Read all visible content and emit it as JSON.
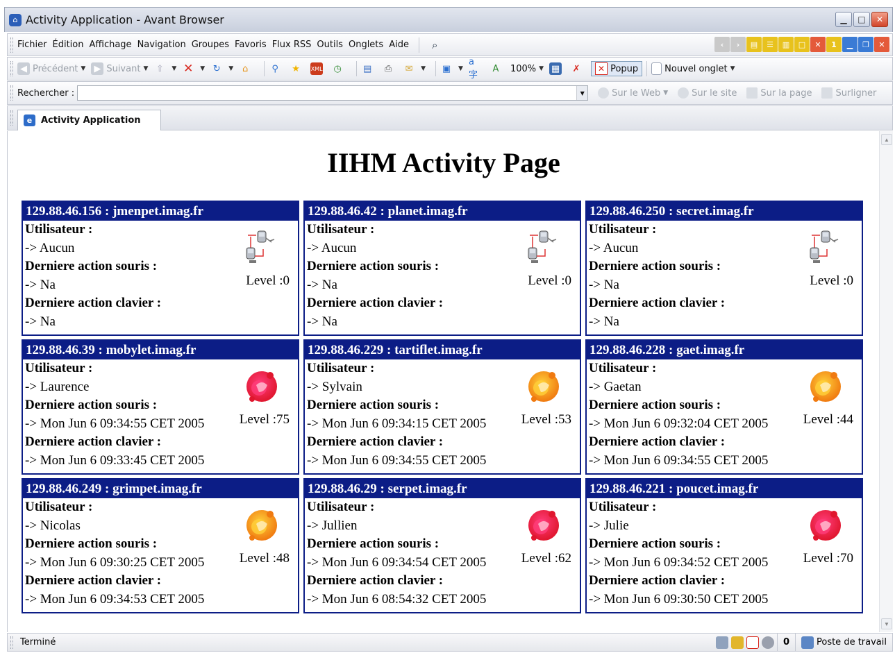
{
  "window": {
    "title": "Activity Application - Avant Browser"
  },
  "menu": [
    "Fichier",
    "Édition",
    "Affichage",
    "Navigation",
    "Groupes",
    "Favoris",
    "Flux RSS",
    "Outils",
    "Onglets",
    "Aide"
  ],
  "toolbar": {
    "back": "Précédent",
    "forward": "Suivant",
    "zoom": "100%",
    "popup": "Popup",
    "new_tab": "Nouvel onglet"
  },
  "search": {
    "label": "Rechercher :",
    "value": "",
    "web": "Sur le Web",
    "site": "Sur le site",
    "page": "Sur la page",
    "highlight": "Surligner"
  },
  "tab": {
    "label": "Activity Application"
  },
  "page": {
    "title": "IIHM Activity Page",
    "labels": {
      "user": "Utilisateur :",
      "mouse": "Derniere action souris :",
      "keyboard": "Derniere action clavier :"
    }
  },
  "machines": [
    {
      "header": "129.88.46.156 : jmenpet.imag.fr",
      "user": "-> Aucun",
      "mouse": "-> Na",
      "keyboard": "-> Na",
      "level": "Level :0",
      "level_value": 0,
      "state": "idle"
    },
    {
      "header": "129.88.46.42 : planet.imag.fr",
      "user": "-> Aucun",
      "mouse": "-> Na",
      "keyboard": "-> Na",
      "level": "Level :0",
      "level_value": 0,
      "state": "idle"
    },
    {
      "header": "129.88.46.250 : secret.imag.fr",
      "user": "-> Aucun",
      "mouse": "-> Na",
      "keyboard": "-> Na",
      "level": "Level :0",
      "level_value": 0,
      "state": "idle"
    },
    {
      "header": "129.88.46.39 : mobylet.imag.fr",
      "user": "-> Laurence",
      "mouse": "-> Mon Jun 6 09:34:55 CET 2005",
      "keyboard": "-> Mon Jun 6 09:33:45 CET 2005",
      "level": "Level :75",
      "level_value": 75,
      "state": "active"
    },
    {
      "header": "129.88.46.229 : tartiflet.imag.fr",
      "user": "-> Sylvain",
      "mouse": "-> Mon Jun 6 09:34:15 CET 2005",
      "keyboard": "-> Mon Jun 6 09:34:55 CET 2005",
      "level": "Level :53",
      "level_value": 53,
      "state": "active"
    },
    {
      "header": "129.88.46.228 : gaet.imag.fr",
      "user": "-> Gaetan",
      "mouse": "-> Mon Jun 6 09:32:04 CET 2005",
      "keyboard": "-> Mon Jun 6 09:34:55 CET 2005",
      "level": "Level :44",
      "level_value": 44,
      "state": "active"
    },
    {
      "header": "129.88.46.249 : grimpet.imag.fr",
      "user": "-> Nicolas",
      "mouse": "-> Mon Jun 6 09:30:25 CET 2005",
      "keyboard": "-> Mon Jun 6 09:34:53 CET 2005",
      "level": "Level :48",
      "level_value": 48,
      "state": "active"
    },
    {
      "header": "129.88.46.29 : serpet.imag.fr",
      "user": "-> Jullien",
      "mouse": "-> Mon Jun 6 09:34:54 CET 2005",
      "keyboard": "-> Mon Jun 6 08:54:32 CET 2005",
      "level": "Level :62",
      "level_value": 62,
      "state": "active"
    },
    {
      "header": "129.88.46.221 : poucet.imag.fr",
      "user": "-> Julie",
      "mouse": "-> Mon Jun 6 09:34:52 CET 2005",
      "keyboard": "-> Mon Jun 6 09:30:50 CET 2005",
      "level": "Level :70",
      "level_value": 70,
      "state": "active"
    }
  ],
  "status": {
    "text": "Terminé",
    "count": "0",
    "zone": "Poste de travail"
  },
  "colors": {
    "card_header": "#0c1d86",
    "accent": "#2c5fb8"
  }
}
